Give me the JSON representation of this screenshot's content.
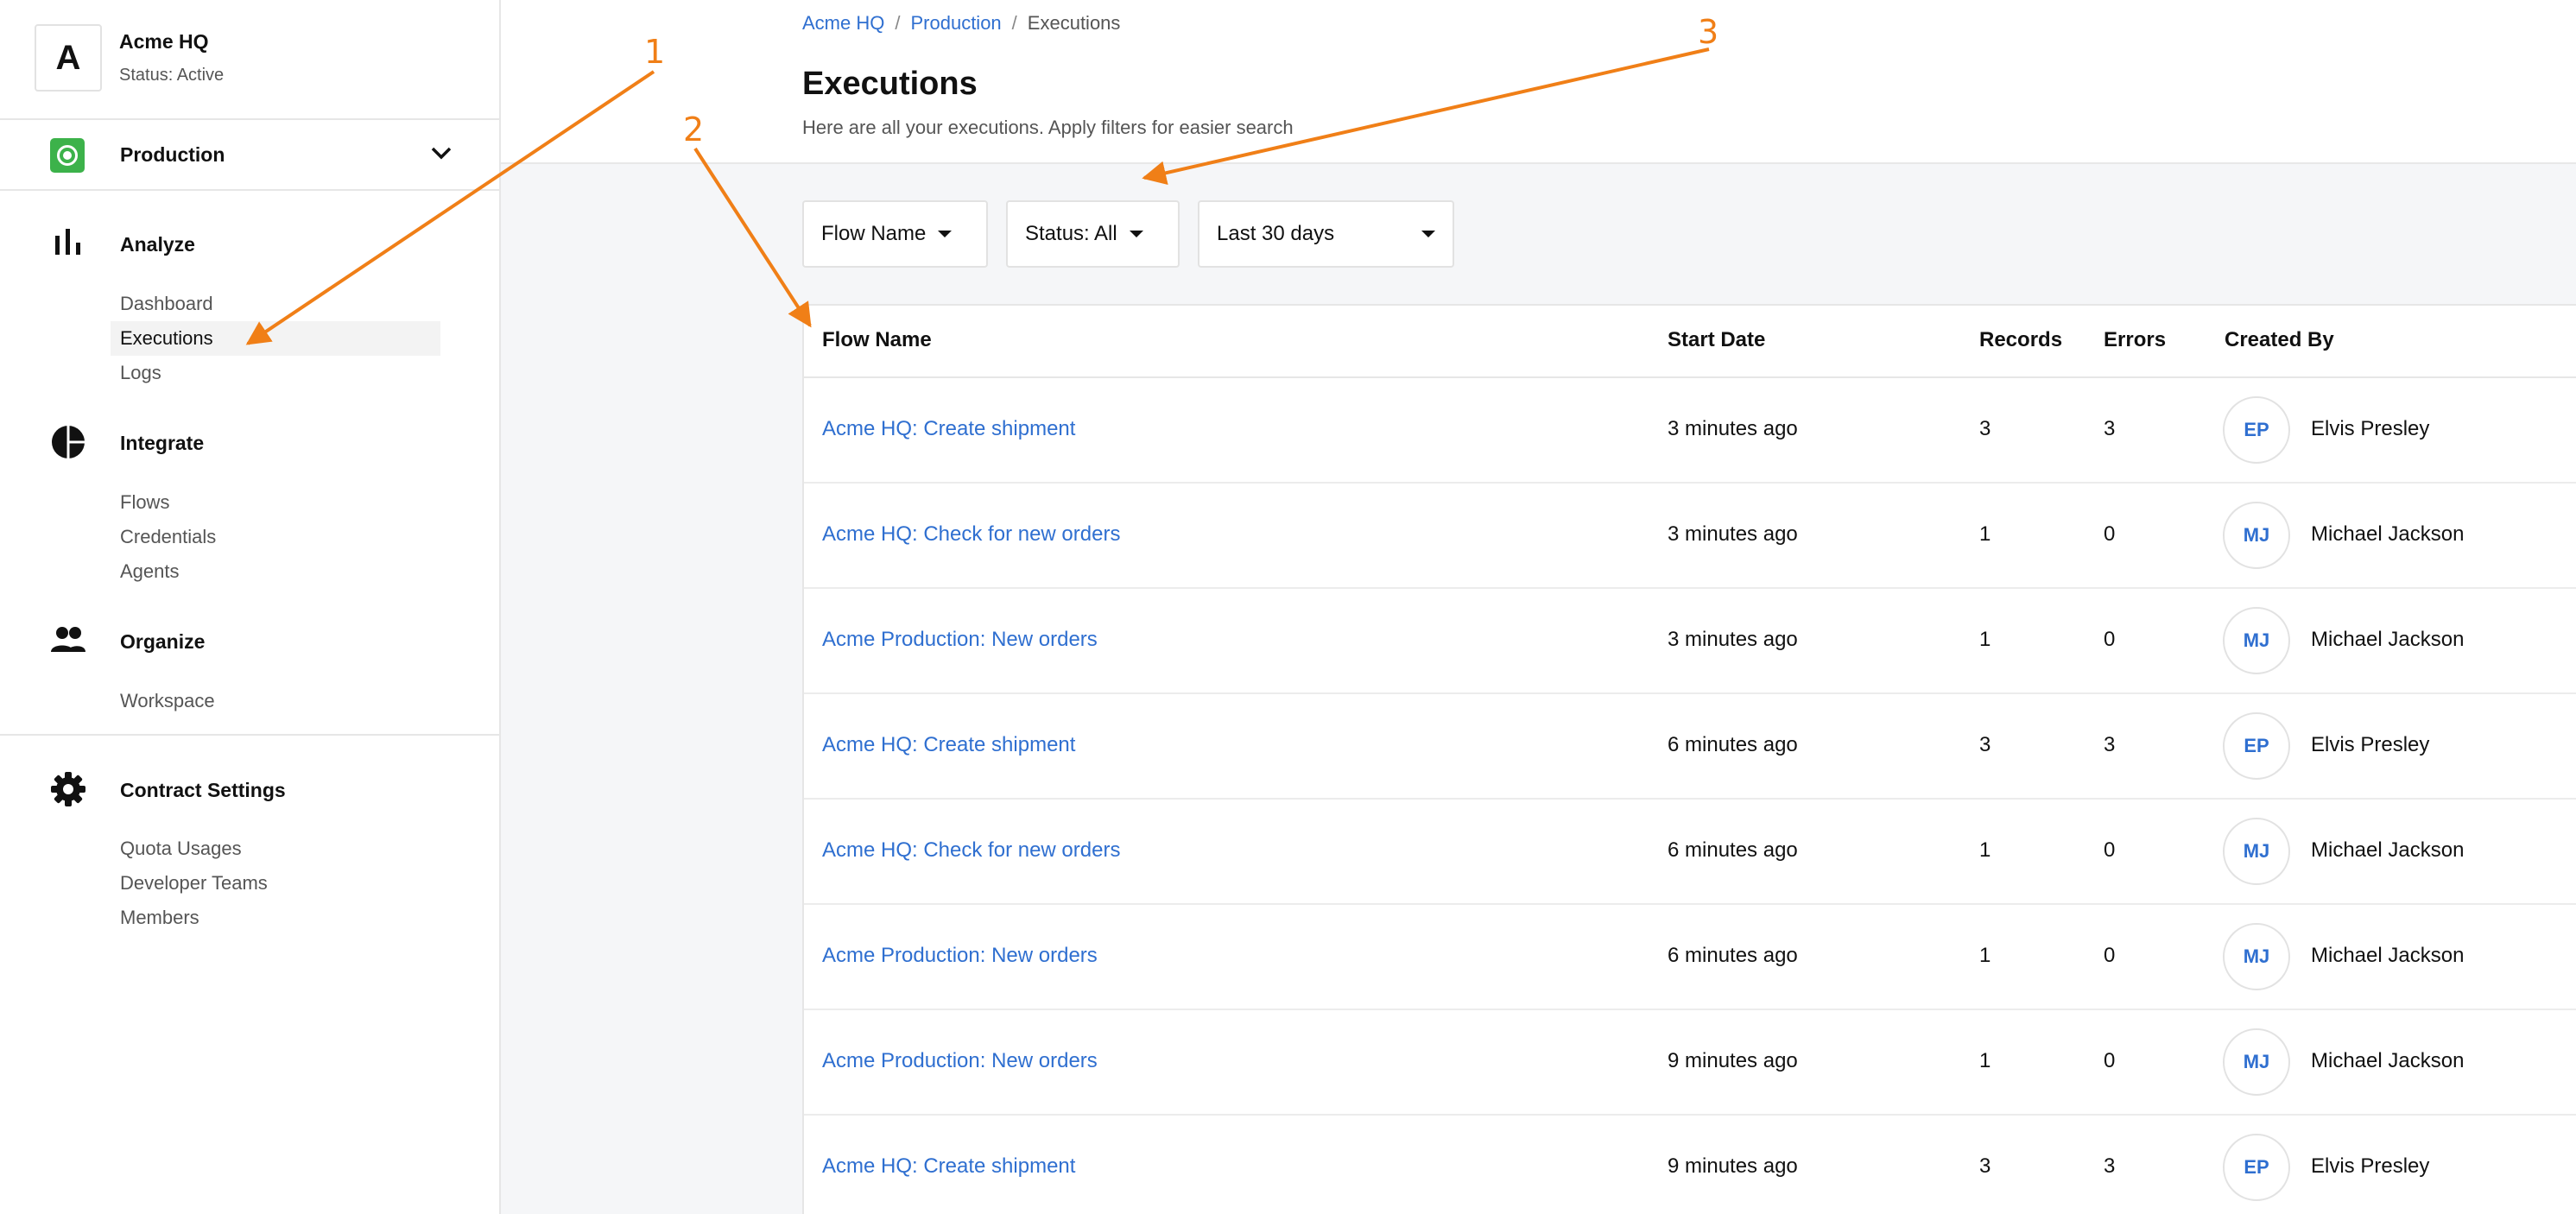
{
  "org": {
    "logo_letter": "A",
    "name": "Acme HQ",
    "status": "Status: Active"
  },
  "environment": {
    "label": "Production",
    "icon": "production-env-icon",
    "color": "#3cb24a"
  },
  "sidebar": {
    "sections": [
      {
        "title": "Analyze",
        "icon": "bar-chart-icon",
        "items": [
          "Dashboard",
          "Executions",
          "Logs"
        ]
      },
      {
        "title": "Integrate",
        "icon": "pie-chart-icon",
        "items": [
          "Flows",
          "Credentials",
          "Agents"
        ]
      },
      {
        "title": "Organize",
        "icon": "people-icon",
        "items": [
          "Workspace"
        ]
      },
      {
        "title": "Contract Settings",
        "icon": "gear-icon",
        "items": [
          "Quota Usages",
          "Developer Teams",
          "Members"
        ]
      }
    ],
    "active_item": "Executions"
  },
  "breadcrumb": {
    "items": [
      "Acme HQ",
      "Production"
    ],
    "separator": "/",
    "current": "Executions"
  },
  "page": {
    "title": "Executions",
    "subtitle": "Here are all your executions. Apply filters for easier search"
  },
  "filters": {
    "flow_name": "Flow Name",
    "status": "Status: All",
    "date_range": "Last 30 days"
  },
  "table": {
    "columns": [
      "Flow Name",
      "Start Date",
      "Records",
      "Errors",
      "Created By"
    ],
    "rows": [
      {
        "flow": "Acme HQ: Create shipment",
        "start": "3 minutes ago",
        "records": "3",
        "errors": "3",
        "initials": "EP",
        "creator": "Elvis Presley"
      },
      {
        "flow": "Acme HQ: Check for new orders",
        "start": "3 minutes ago",
        "records": "1",
        "errors": "0",
        "initials": "MJ",
        "creator": "Michael Jackson"
      },
      {
        "flow": "Acme Production: New orders",
        "start": "3 minutes ago",
        "records": "1",
        "errors": "0",
        "initials": "MJ",
        "creator": "Michael Jackson"
      },
      {
        "flow": "Acme HQ: Create shipment",
        "start": "6 minutes ago",
        "records": "3",
        "errors": "3",
        "initials": "EP",
        "creator": "Elvis Presley"
      },
      {
        "flow": "Acme HQ: Check for new orders",
        "start": "6 minutes ago",
        "records": "1",
        "errors": "0",
        "initials": "MJ",
        "creator": "Michael Jackson"
      },
      {
        "flow": "Acme Production: New orders",
        "start": "6 minutes ago",
        "records": "1",
        "errors": "0",
        "initials": "MJ",
        "creator": "Michael Jackson"
      },
      {
        "flow": "Acme Production: New orders",
        "start": "9 minutes ago",
        "records": "1",
        "errors": "0",
        "initials": "MJ",
        "creator": "Michael Jackson"
      },
      {
        "flow": "Acme HQ: Create shipment",
        "start": "9 minutes ago",
        "records": "3",
        "errors": "3",
        "initials": "EP",
        "creator": "Elvis Presley"
      }
    ]
  },
  "annotations": {
    "labels": [
      "1",
      "2",
      "3"
    ],
    "color": "#f07f17"
  },
  "colors": {
    "link": "#2f6fd0",
    "page_background": "#f5f6f8"
  }
}
